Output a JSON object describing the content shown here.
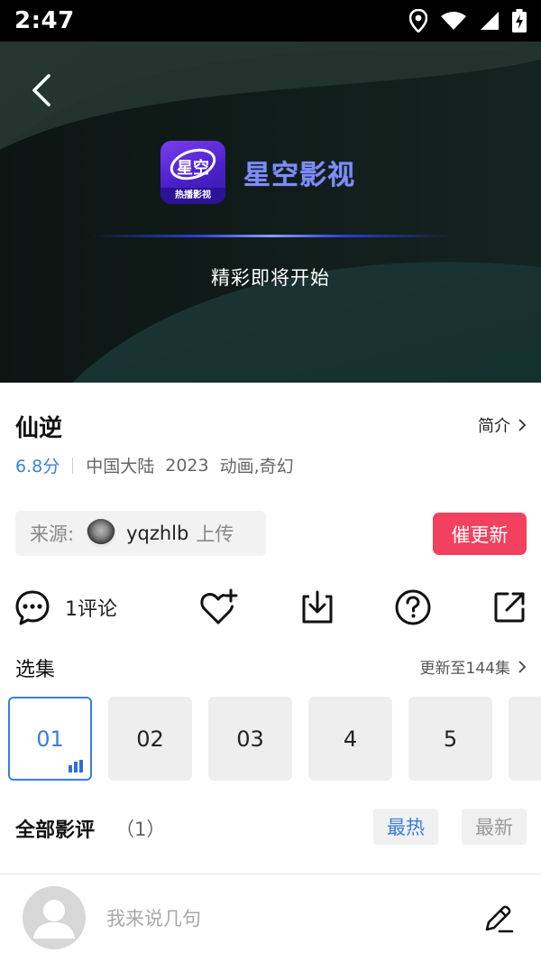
{
  "status_bar": {
    "time": "2:47",
    "icons": [
      "location-icon",
      "wifi-icon",
      "signal-icon",
      "battery-charging-icon"
    ]
  },
  "player": {
    "brand_name": "星空影视",
    "logo_mark": "星空",
    "logo_band": "热播影视",
    "loading_text": "精彩即将开始",
    "brand_color": "#7e8df5"
  },
  "video": {
    "title": "仙逆",
    "intro_label": "简介",
    "score": "6.8分",
    "region": "中国大陆",
    "year": "2023",
    "genres": "动画,奇幻"
  },
  "source": {
    "prefix": "来源:",
    "uploader": "yqzhlb",
    "suffix": "上传"
  },
  "urge_update_label": "催更新",
  "actions": {
    "comments_label": "1评论",
    "icons": [
      "comment-icon",
      "favorite-add-icon",
      "download-icon",
      "help-icon",
      "share-icon"
    ]
  },
  "episodes": {
    "section_title": "选集",
    "update_label": "更新至144集",
    "items": [
      "01",
      "02",
      "03",
      "4",
      "5"
    ],
    "active": "01"
  },
  "reviews": {
    "title": "全部影评",
    "count": "（1）",
    "sort_hot": "最热",
    "sort_new": "最新"
  },
  "comment_box": {
    "placeholder": "我来说几句"
  },
  "colors": {
    "accent_blue": "#3b7de0",
    "urge_red": "#f2405f",
    "score_blue": "#3b82e0"
  }
}
